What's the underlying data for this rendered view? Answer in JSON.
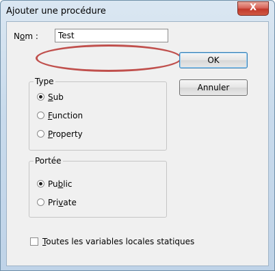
{
  "window": {
    "title": "Ajouter une procédure",
    "close_glyph": "X"
  },
  "name_field": {
    "label_pre": "N",
    "label_access": "o",
    "label_post": "m :",
    "value": "Test"
  },
  "buttons": {
    "ok": "OK",
    "cancel": "Annuler"
  },
  "type_group": {
    "legend": "Type",
    "options": [
      {
        "pre": "",
        "access": "S",
        "post": "ub",
        "selected": true
      },
      {
        "pre": "",
        "access": "F",
        "post": "unction",
        "selected": false
      },
      {
        "pre": "",
        "access": "P",
        "post": "roperty",
        "selected": false
      }
    ]
  },
  "scope_group": {
    "legend": "Portée",
    "options": [
      {
        "pre": "Pu",
        "access": "b",
        "post": "lic",
        "selected": true
      },
      {
        "pre": "Pri",
        "access": "v",
        "post": "ate",
        "selected": false
      }
    ]
  },
  "static_checkbox": {
    "pre": "",
    "access": "T",
    "post": "outes les variables locales statiques",
    "checked": false
  },
  "highlight_color": "#c0504d"
}
